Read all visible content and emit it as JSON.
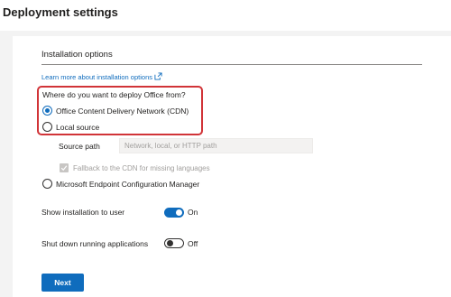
{
  "page_title": "Deployment settings",
  "section": {
    "title": "Installation options",
    "learn_more": "Learn more about installation options"
  },
  "question": "Where do you want to deploy Office from?",
  "options": [
    {
      "label": "Office Content Delivery Network (CDN)",
      "selected": true
    },
    {
      "label": "Local source",
      "selected": false
    },
    {
      "label": "Microsoft Endpoint Configuration Manager",
      "selected": false
    }
  ],
  "source_path": {
    "label": "Source path",
    "placeholder": "Network, local, or HTTP path"
  },
  "fallback": {
    "label": "Fallback to the CDN for missing languages",
    "checked": true,
    "disabled": true
  },
  "show_installation": {
    "label": "Show installation to user",
    "state": "On"
  },
  "shut_down_apps": {
    "label": "Shut down running applications",
    "state": "Off"
  },
  "next_label": "Next",
  "colors": {
    "accent": "#0f6cbd",
    "highlight": "#d13438"
  }
}
